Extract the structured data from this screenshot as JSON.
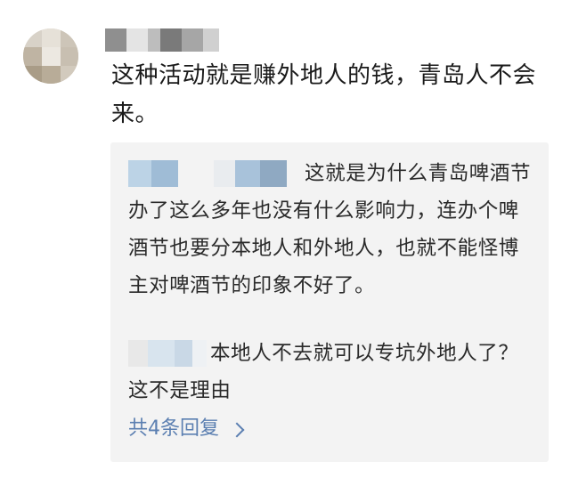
{
  "comment": {
    "text": "这种活动就是赚外地人的钱，青岛人不会来。"
  },
  "replies": [
    {
      "text": "这就是为什么青岛啤酒节办了这么多年也没有什么影响力，连办个啤酒节也要分本地人和外地人，也就不能怪博主对啤酒节的印象不好了。"
    },
    {
      "text": "本地人不去就可以专坑外地人了？这不是理由"
    }
  ],
  "more_replies": {
    "label": "共4条回复",
    "icon": "chevron-right-icon"
  },
  "colors": {
    "link": "#5b7fb1",
    "reply_background": "#f3f3f3",
    "text": "#1a1a1a"
  }
}
